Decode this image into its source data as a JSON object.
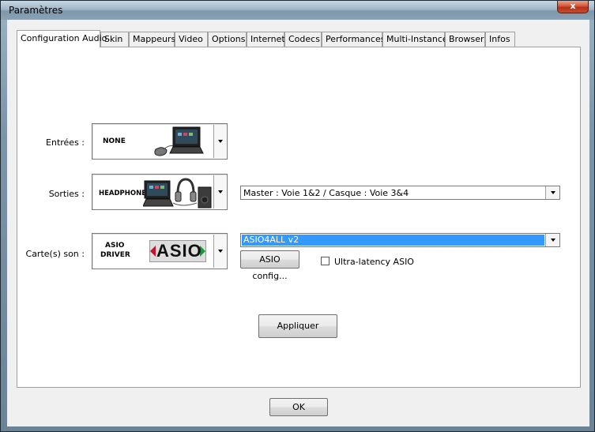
{
  "window": {
    "title": "Paramètres",
    "close_label": "x"
  },
  "tabs": [
    {
      "label": "Configuration Audio"
    },
    {
      "label": "Skin"
    },
    {
      "label": "Mappeurs"
    },
    {
      "label": "Video"
    },
    {
      "label": "Options"
    },
    {
      "label": "Internet"
    },
    {
      "label": "Codecs"
    },
    {
      "label": "Performances"
    },
    {
      "label": "Multi-Instance"
    },
    {
      "label": "Browser"
    },
    {
      "label": "Infos"
    }
  ],
  "inputs": {
    "label": "Entrées :",
    "device": "NONE"
  },
  "outputs": {
    "label": "Sorties :",
    "device": "HEADPHONES",
    "routing": "Master : Voie 1&2 / Casque : Voie 3&4"
  },
  "soundcard": {
    "label": "Carte(s) son :",
    "device_line1": "ASIO",
    "device_line2": "DRIVER",
    "logo_text": "ASIO",
    "driver": "ASIO4ALL v2",
    "config_button": "ASIO config...",
    "ultralatency_label": "Ultra-latency ASIO",
    "ultralatency_checked": false
  },
  "apply_button": "Appliquer",
  "ok_button": "OK",
  "colors": {
    "selection": "#3399ff",
    "asio_red": "#c8102e",
    "asio_green": "#1a9a3a"
  }
}
